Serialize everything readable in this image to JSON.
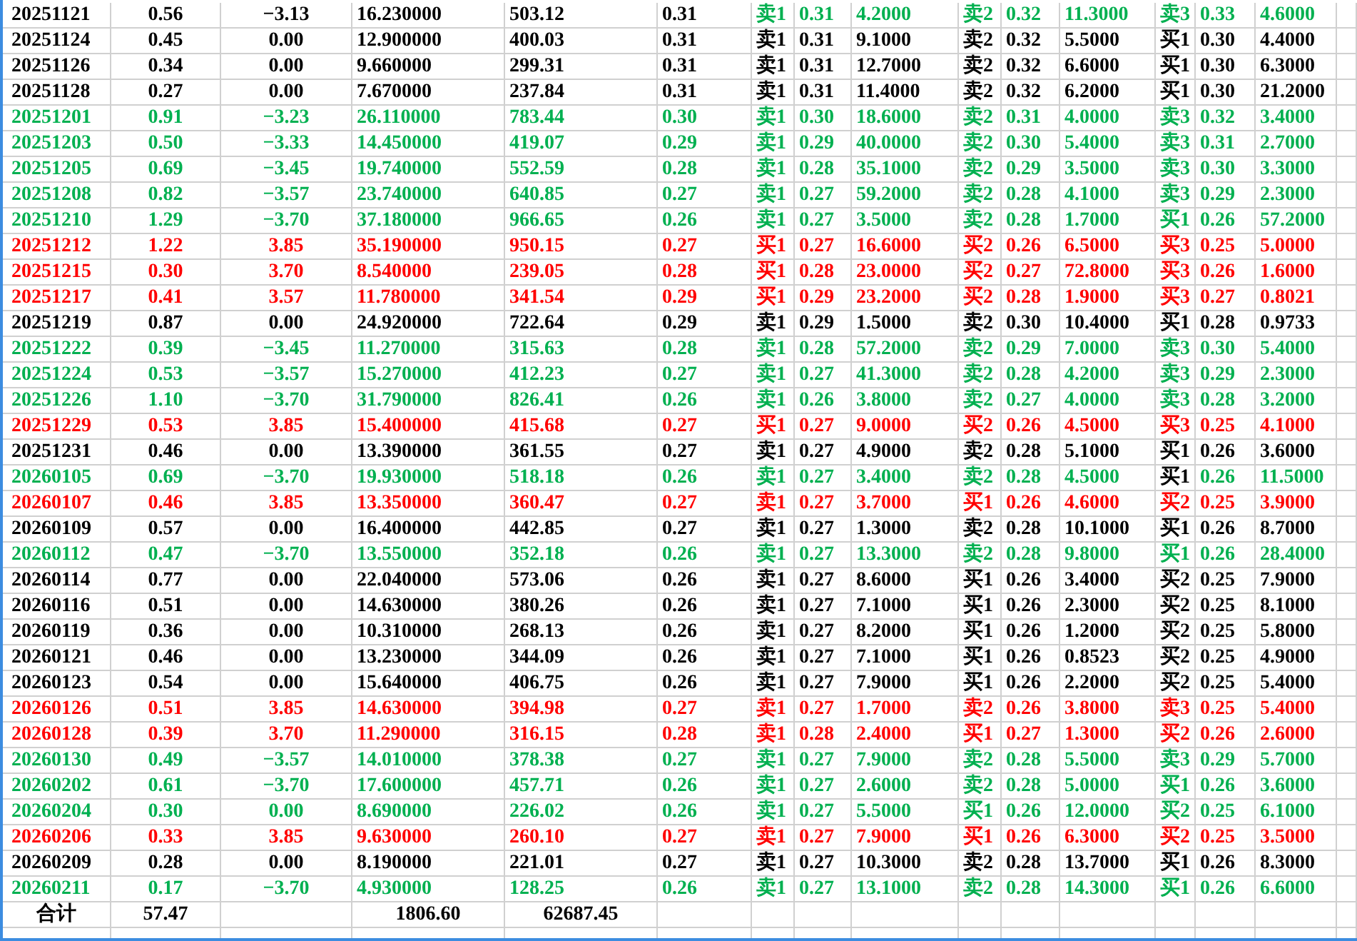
{
  "rows": [
    {
      "cells": [
        "20251121",
        "0.56",
        "−3.13",
        "16.230000",
        "503.12"
      ],
      "color": "#000000",
      "price": {
        "value": "0.31",
        "color": "#000000"
      },
      "levels": [
        {
          "label": "卖1",
          "price": "0.31",
          "volume": "4.2000",
          "color": "#00b050"
        },
        {
          "label": "卖2",
          "price": "0.32",
          "volume": "11.3000",
          "color": "#00b050"
        },
        {
          "label": "卖3",
          "price": "0.33",
          "volume": "4.6000",
          "color": "#00b050"
        }
      ]
    },
    {
      "cells": [
        "20251124",
        "0.45",
        "0.00",
        "12.900000",
        "400.03"
      ],
      "color": "#000000",
      "price": {
        "value": "0.31",
        "color": "#000000"
      },
      "levels": [
        {
          "label": "卖1",
          "price": "0.31",
          "volume": "9.1000",
          "color": "#000000"
        },
        {
          "label": "卖2",
          "price": "0.32",
          "volume": "5.5000",
          "color": "#000000"
        },
        {
          "label": "买1",
          "price": "0.30",
          "volume": "4.4000",
          "color": "#000000"
        }
      ]
    },
    {
      "cells": [
        "20251126",
        "0.34",
        "0.00",
        "9.660000",
        "299.31"
      ],
      "color": "#000000",
      "price": {
        "value": "0.31",
        "color": "#000000"
      },
      "levels": [
        {
          "label": "卖1",
          "price": "0.31",
          "volume": "12.7000",
          "color": "#000000"
        },
        {
          "label": "卖2",
          "price": "0.32",
          "volume": "6.6000",
          "color": "#000000"
        },
        {
          "label": "买1",
          "price": "0.30",
          "volume": "6.3000",
          "color": "#000000"
        }
      ]
    },
    {
      "cells": [
        "20251128",
        "0.27",
        "0.00",
        "7.670000",
        "237.84"
      ],
      "color": "#000000",
      "price": {
        "value": "0.31",
        "color": "#000000"
      },
      "levels": [
        {
          "label": "卖1",
          "price": "0.31",
          "volume": "11.4000",
          "color": "#000000"
        },
        {
          "label": "卖2",
          "price": "0.32",
          "volume": "6.2000",
          "color": "#000000"
        },
        {
          "label": "买1",
          "price": "0.30",
          "volume": "21.2000",
          "color": "#000000"
        }
      ]
    },
    {
      "cells": [
        "20251201",
        "0.91",
        "−3.23",
        "26.110000",
        "783.44"
      ],
      "color": "#00b050",
      "price": {
        "value": "0.30",
        "color": "#00b050"
      },
      "levels": [
        {
          "label": "卖1",
          "price": "0.30",
          "volume": "18.6000",
          "color": "#00b050"
        },
        {
          "label": "卖2",
          "price": "0.31",
          "volume": "4.0000",
          "color": "#00b050"
        },
        {
          "label": "卖3",
          "price": "0.32",
          "volume": "3.4000",
          "color": "#00b050"
        }
      ]
    },
    {
      "cells": [
        "20251203",
        "0.50",
        "−3.33",
        "14.450000",
        "419.07"
      ],
      "color": "#00b050",
      "price": {
        "value": "0.29",
        "color": "#00b050"
      },
      "levels": [
        {
          "label": "卖1",
          "price": "0.29",
          "volume": "40.0000",
          "color": "#00b050"
        },
        {
          "label": "卖2",
          "price": "0.30",
          "volume": "5.4000",
          "color": "#00b050"
        },
        {
          "label": "卖3",
          "price": "0.31",
          "volume": "2.7000",
          "color": "#00b050"
        }
      ]
    },
    {
      "cells": [
        "20251205",
        "0.69",
        "−3.45",
        "19.740000",
        "552.59"
      ],
      "color": "#00b050",
      "price": {
        "value": "0.28",
        "color": "#00b050"
      },
      "levels": [
        {
          "label": "卖1",
          "price": "0.28",
          "volume": "35.1000",
          "color": "#00b050"
        },
        {
          "label": "卖2",
          "price": "0.29",
          "volume": "3.5000",
          "color": "#00b050"
        },
        {
          "label": "卖3",
          "price": "0.30",
          "volume": "3.3000",
          "color": "#00b050"
        }
      ]
    },
    {
      "cells": [
        "20251208",
        "0.82",
        "−3.57",
        "23.740000",
        "640.85"
      ],
      "color": "#00b050",
      "price": {
        "value": "0.27",
        "color": "#00b050"
      },
      "levels": [
        {
          "label": "卖1",
          "price": "0.27",
          "volume": "59.2000",
          "color": "#00b050"
        },
        {
          "label": "卖2",
          "price": "0.28",
          "volume": "4.1000",
          "color": "#00b050"
        },
        {
          "label": "卖3",
          "price": "0.29",
          "volume": "2.3000",
          "color": "#00b050"
        }
      ]
    },
    {
      "cells": [
        "20251210",
        "1.29",
        "−3.70",
        "37.180000",
        "966.65"
      ],
      "color": "#00b050",
      "price": {
        "value": "0.26",
        "color": "#00b050"
      },
      "levels": [
        {
          "label": "卖1",
          "price": "0.27",
          "volume": "3.5000",
          "color": "#00b050"
        },
        {
          "label": "卖2",
          "price": "0.28",
          "volume": "1.7000",
          "color": "#00b050"
        },
        {
          "label": "买1",
          "price": "0.26",
          "volume": "57.2000",
          "color": "#00b050"
        }
      ]
    },
    {
      "cells": [
        "20251212",
        "1.22",
        "3.85",
        "35.190000",
        "950.15"
      ],
      "color": "#ff0000",
      "price": {
        "value": "0.27",
        "color": "#ff0000"
      },
      "levels": [
        {
          "label": "买1",
          "price": "0.27",
          "volume": "16.6000",
          "color": "#ff0000"
        },
        {
          "label": "买2",
          "price": "0.26",
          "volume": "6.5000",
          "color": "#ff0000"
        },
        {
          "label": "买3",
          "price": "0.25",
          "volume": "5.0000",
          "color": "#ff0000"
        }
      ]
    },
    {
      "cells": [
        "20251215",
        "0.30",
        "3.70",
        "8.540000",
        "239.05"
      ],
      "color": "#ff0000",
      "price": {
        "value": "0.28",
        "color": "#ff0000"
      },
      "levels": [
        {
          "label": "买1",
          "price": "0.28",
          "volume": "23.0000",
          "color": "#ff0000"
        },
        {
          "label": "买2",
          "price": "0.27",
          "volume": "72.8000",
          "color": "#ff0000"
        },
        {
          "label": "买3",
          "price": "0.26",
          "volume": "1.6000",
          "color": "#ff0000"
        }
      ]
    },
    {
      "cells": [
        "20251217",
        "0.41",
        "3.57",
        "11.780000",
        "341.54"
      ],
      "color": "#ff0000",
      "price": {
        "value": "0.29",
        "color": "#ff0000"
      },
      "levels": [
        {
          "label": "买1",
          "price": "0.29",
          "volume": "23.2000",
          "color": "#ff0000"
        },
        {
          "label": "买2",
          "price": "0.28",
          "volume": "1.9000",
          "color": "#ff0000"
        },
        {
          "label": "买3",
          "price": "0.27",
          "volume": "0.8021",
          "color": "#ff0000"
        }
      ]
    },
    {
      "cells": [
        "20251219",
        "0.87",
        "0.00",
        "24.920000",
        "722.64"
      ],
      "color": "#000000",
      "price": {
        "value": "0.29",
        "color": "#000000"
      },
      "levels": [
        {
          "label": "卖1",
          "price": "0.29",
          "volume": "1.5000",
          "color": "#000000"
        },
        {
          "label": "卖2",
          "price": "0.30",
          "volume": "10.4000",
          "color": "#000000"
        },
        {
          "label": "买1",
          "price": "0.28",
          "volume": "0.9733",
          "color": "#000000"
        }
      ]
    },
    {
      "cells": [
        "20251222",
        "0.39",
        "−3.45",
        "11.270000",
        "315.63"
      ],
      "color": "#00b050",
      "price": {
        "value": "0.28",
        "color": "#00b050"
      },
      "levels": [
        {
          "label": "卖1",
          "price": "0.28",
          "volume": "57.2000",
          "color": "#00b050"
        },
        {
          "label": "卖2",
          "price": "0.29",
          "volume": "7.0000",
          "color": "#00b050"
        },
        {
          "label": "卖3",
          "price": "0.30",
          "volume": "5.4000",
          "color": "#00b050"
        }
      ]
    },
    {
      "cells": [
        "20251224",
        "0.53",
        "−3.57",
        "15.270000",
        "412.23"
      ],
      "color": "#00b050",
      "price": {
        "value": "0.27",
        "color": "#00b050"
      },
      "levels": [
        {
          "label": "卖1",
          "price": "0.27",
          "volume": "41.3000",
          "color": "#00b050"
        },
        {
          "label": "卖2",
          "price": "0.28",
          "volume": "4.2000",
          "color": "#00b050"
        },
        {
          "label": "卖3",
          "price": "0.29",
          "volume": "2.3000",
          "color": "#00b050"
        }
      ]
    },
    {
      "cells": [
        "20251226",
        "1.10",
        "−3.70",
        "31.790000",
        "826.41"
      ],
      "color": "#00b050",
      "price": {
        "value": "0.26",
        "color": "#00b050"
      },
      "levels": [
        {
          "label": "卖1",
          "price": "0.26",
          "volume": "3.8000",
          "color": "#00b050"
        },
        {
          "label": "卖2",
          "price": "0.27",
          "volume": "4.0000",
          "color": "#00b050"
        },
        {
          "label": "卖3",
          "price": "0.28",
          "volume": "3.2000",
          "color": "#00b050"
        }
      ]
    },
    {
      "cells": [
        "20251229",
        "0.53",
        "3.85",
        "15.400000",
        "415.68"
      ],
      "color": "#ff0000",
      "price": {
        "value": "0.27",
        "color": "#ff0000"
      },
      "levels": [
        {
          "label": "买1",
          "price": "0.27",
          "volume": "9.0000",
          "color": "#ff0000"
        },
        {
          "label": "买2",
          "price": "0.26",
          "volume": "4.5000",
          "color": "#ff0000"
        },
        {
          "label": "买3",
          "price": "0.25",
          "volume": "4.1000",
          "color": "#ff0000"
        }
      ]
    },
    {
      "cells": [
        "20251231",
        "0.46",
        "0.00",
        "13.390000",
        "361.55"
      ],
      "color": "#000000",
      "price": {
        "value": "0.27",
        "color": "#000000"
      },
      "levels": [
        {
          "label": "卖1",
          "price": "0.27",
          "volume": "4.9000",
          "color": "#000000"
        },
        {
          "label": "卖2",
          "price": "0.28",
          "volume": "5.1000",
          "color": "#000000"
        },
        {
          "label": "买1",
          "price": "0.26",
          "volume": "3.6000",
          "color": "#000000"
        }
      ]
    },
    {
      "cells": [
        "20260105",
        "0.69",
        "−3.70",
        "19.930000",
        "518.18"
      ],
      "color": "#00b050",
      "price": {
        "value": "0.26",
        "color": "#00b050"
      },
      "levels": [
        {
          "label": "卖1",
          "price": "0.27",
          "volume": "3.4000",
          "color": "#00b050"
        },
        {
          "label": "卖2",
          "price": "0.28",
          "volume": "4.5000",
          "color": "#00b050"
        },
        {
          "label": {
            "text": "买1",
            "color": "#000000"
          },
          "price": "0.26",
          "volume": "11.5000",
          "color": "#00b050"
        }
      ]
    },
    {
      "cells": [
        "20260107",
        "0.46",
        "3.85",
        "13.350000",
        "360.47"
      ],
      "color": "#ff0000",
      "price": {
        "value": "0.27",
        "color": "#ff0000"
      },
      "levels": [
        {
          "label": "卖1",
          "price": "0.27",
          "volume": "3.7000",
          "color": "#ff0000"
        },
        {
          "label": "买1",
          "price": "0.26",
          "volume": "4.6000",
          "color": "#ff0000"
        },
        {
          "label": "买2",
          "price": "0.25",
          "volume": "3.9000",
          "color": "#ff0000"
        }
      ]
    },
    {
      "cells": [
        "20260109",
        "0.57",
        "0.00",
        "16.400000",
        "442.85"
      ],
      "color": "#000000",
      "price": {
        "value": "0.27",
        "color": "#000000"
      },
      "levels": [
        {
          "label": "卖1",
          "price": "0.27",
          "volume": "1.3000",
          "color": "#000000"
        },
        {
          "label": "卖2",
          "price": "0.28",
          "volume": "10.1000",
          "color": "#000000"
        },
        {
          "label": "买1",
          "price": "0.26",
          "volume": "8.7000",
          "color": "#000000"
        }
      ]
    },
    {
      "cells": [
        "20260112",
        "0.47",
        "−3.70",
        "13.550000",
        "352.18"
      ],
      "color": "#00b050",
      "price": {
        "value": "0.26",
        "color": "#00b050"
      },
      "levels": [
        {
          "label": "卖1",
          "price": "0.27",
          "volume": "13.3000",
          "color": "#00b050"
        },
        {
          "label": "卖2",
          "price": "0.28",
          "volume": "9.8000",
          "color": "#00b050"
        },
        {
          "label": "买1",
          "price": "0.26",
          "volume": "28.4000",
          "color": "#00b050"
        }
      ]
    },
    {
      "cells": [
        "20260114",
        "0.77",
        "0.00",
        "22.040000",
        "573.06"
      ],
      "color": "#000000",
      "price": {
        "value": "0.26",
        "color": "#000000"
      },
      "levels": [
        {
          "label": "卖1",
          "price": "0.27",
          "volume": "8.6000",
          "color": "#000000"
        },
        {
          "label": "买1",
          "price": "0.26",
          "volume": "3.4000",
          "color": "#000000"
        },
        {
          "label": "买2",
          "price": "0.25",
          "volume": "7.9000",
          "color": "#000000"
        }
      ]
    },
    {
      "cells": [
        "20260116",
        "0.51",
        "0.00",
        "14.630000",
        "380.26"
      ],
      "color": "#000000",
      "price": {
        "value": "0.26",
        "color": "#000000"
      },
      "levels": [
        {
          "label": "卖1",
          "price": "0.27",
          "volume": "7.1000",
          "color": "#000000"
        },
        {
          "label": "买1",
          "price": "0.26",
          "volume": "2.3000",
          "color": "#000000"
        },
        {
          "label": "买2",
          "price": "0.25",
          "volume": "8.1000",
          "color": "#000000"
        }
      ]
    },
    {
      "cells": [
        "20260119",
        "0.36",
        "0.00",
        "10.310000",
        "268.13"
      ],
      "color": "#000000",
      "price": {
        "value": "0.26",
        "color": "#000000"
      },
      "levels": [
        {
          "label": "卖1",
          "price": "0.27",
          "volume": "8.2000",
          "color": "#000000"
        },
        {
          "label": "买1",
          "price": "0.26",
          "volume": "1.2000",
          "color": "#000000"
        },
        {
          "label": "买2",
          "price": "0.25",
          "volume": "5.8000",
          "color": "#000000"
        }
      ]
    },
    {
      "cells": [
        "20260121",
        "0.46",
        "0.00",
        "13.230000",
        "344.09"
      ],
      "color": "#000000",
      "price": {
        "value": "0.26",
        "color": "#000000"
      },
      "levels": [
        {
          "label": "卖1",
          "price": "0.27",
          "volume": "7.1000",
          "color": "#000000"
        },
        {
          "label": "买1",
          "price": "0.26",
          "volume": "0.8523",
          "color": "#000000"
        },
        {
          "label": "买2",
          "price": "0.25",
          "volume": "4.9000",
          "color": "#000000"
        }
      ]
    },
    {
      "cells": [
        "20260123",
        "0.54",
        "0.00",
        "15.640000",
        "406.75"
      ],
      "color": "#000000",
      "price": {
        "value": "0.26",
        "color": "#000000"
      },
      "levels": [
        {
          "label": "卖1",
          "price": "0.27",
          "volume": "7.9000",
          "color": "#000000"
        },
        {
          "label": "买1",
          "price": "0.26",
          "volume": "2.2000",
          "color": "#000000"
        },
        {
          "label": "买2",
          "price": "0.25",
          "volume": "5.4000",
          "color": "#000000"
        }
      ]
    },
    {
      "cells": [
        "20260126",
        "0.51",
        "3.85",
        "14.630000",
        "394.98"
      ],
      "color": "#ff0000",
      "price": {
        "value": "0.27",
        "color": "#ff0000"
      },
      "levels": [
        {
          "label": "卖1",
          "price": "0.27",
          "volume": "1.7000",
          "color": "#ff0000"
        },
        {
          "label": "卖2",
          "price": "0.26",
          "volume": "3.8000",
          "color": "#ff0000"
        },
        {
          "label": "卖3",
          "price": "0.25",
          "volume": "5.4000",
          "color": "#ff0000"
        }
      ]
    },
    {
      "cells": [
        "20260128",
        "0.39",
        "3.70",
        "11.290000",
        "316.15"
      ],
      "color": "#ff0000",
      "price": {
        "value": "0.28",
        "color": "#ff0000"
      },
      "levels": [
        {
          "label": "卖1",
          "price": "0.28",
          "volume": "2.4000",
          "color": "#ff0000"
        },
        {
          "label": "买1",
          "price": "0.27",
          "volume": "1.3000",
          "color": "#ff0000"
        },
        {
          "label": "买2",
          "price": "0.26",
          "volume": "2.6000",
          "color": "#ff0000"
        }
      ]
    },
    {
      "cells": [
        "20260130",
        "0.49",
        "−3.57",
        "14.010000",
        "378.38"
      ],
      "color": "#00b050",
      "price": {
        "value": "0.27",
        "color": "#00b050"
      },
      "levels": [
        {
          "label": "卖1",
          "price": "0.27",
          "volume": "7.9000",
          "color": "#00b050"
        },
        {
          "label": "卖2",
          "price": "0.28",
          "volume": "5.5000",
          "color": "#00b050"
        },
        {
          "label": "卖3",
          "price": "0.29",
          "volume": "5.7000",
          "color": "#00b050"
        }
      ]
    },
    {
      "cells": [
        "20260202",
        "0.61",
        "−3.70",
        "17.600000",
        "457.71"
      ],
      "color": "#00b050",
      "price": {
        "value": "0.26",
        "color": "#00b050"
      },
      "levels": [
        {
          "label": "卖1",
          "price": "0.27",
          "volume": "2.6000",
          "color": "#00b050"
        },
        {
          "label": "卖2",
          "price": "0.28",
          "volume": "5.0000",
          "color": "#00b050"
        },
        {
          "label": "买1",
          "price": "0.26",
          "volume": "3.6000",
          "color": "#00b050"
        }
      ]
    },
    {
      "cells": [
        "20260204",
        "0.30",
        "0.00",
        "8.690000",
        "226.02"
      ],
      "color": "#00b050",
      "price": {
        "value": "0.26",
        "color": "#00b050"
      },
      "levels": [
        {
          "label": "卖1",
          "price": "0.27",
          "volume": "5.5000",
          "color": "#00b050"
        },
        {
          "label": "买1",
          "price": "0.26",
          "volume": "12.0000",
          "color": "#00b050"
        },
        {
          "label": "买2",
          "price": "0.25",
          "volume": "6.1000",
          "color": "#00b050"
        }
      ]
    },
    {
      "cells": [
        "20260206",
        "0.33",
        "3.85",
        "9.630000",
        "260.10"
      ],
      "color": "#ff0000",
      "price": {
        "value": "0.27",
        "color": "#ff0000"
      },
      "levels": [
        {
          "label": "卖1",
          "price": "0.27",
          "volume": "7.9000",
          "color": "#ff0000"
        },
        {
          "label": "买1",
          "price": "0.26",
          "volume": "6.3000",
          "color": "#ff0000"
        },
        {
          "label": "买2",
          "price": "0.25",
          "volume": "3.5000",
          "color": "#ff0000"
        }
      ]
    },
    {
      "cells": [
        "20260209",
        "0.28",
        "0.00",
        "8.190000",
        "221.01"
      ],
      "color": "#000000",
      "price": {
        "value": "0.27",
        "color": "#000000"
      },
      "levels": [
        {
          "label": "卖1",
          "price": "0.27",
          "volume": "10.3000",
          "color": "#000000"
        },
        {
          "label": "卖2",
          "price": "0.28",
          "volume": "13.7000",
          "color": "#000000"
        },
        {
          "label": "买1",
          "price": "0.26",
          "volume": "8.3000",
          "color": "#000000"
        }
      ]
    },
    {
      "cells": [
        "20260211",
        "0.17",
        "−3.70",
        "4.930000",
        "128.25"
      ],
      "color": "#00b050",
      "price": {
        "value": "0.26",
        "color": "#00b050"
      },
      "levels": [
        {
          "label": "卖1",
          "price": "0.27",
          "volume": "13.1000",
          "color": "#00b050"
        },
        {
          "label": "卖2",
          "price": "0.28",
          "volume": "14.3000",
          "color": "#00b050"
        },
        {
          "label": "买1",
          "price": "0.26",
          "volume": "6.6000",
          "color": "#00b050"
        }
      ]
    }
  ],
  "total": {
    "label": "合计",
    "column_2": "57.47",
    "column_4": "1806.60",
    "column_5": "62687.45"
  }
}
